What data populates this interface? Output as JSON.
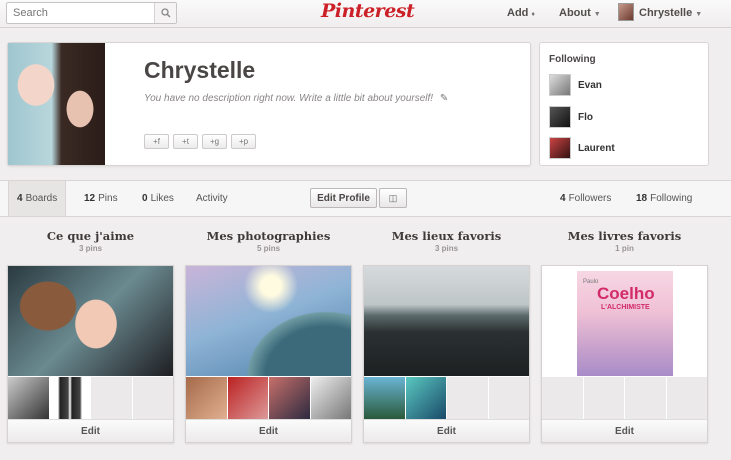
{
  "header": {
    "search_placeholder": "Search",
    "logo": "Pinterest",
    "add_label": "Add",
    "about_label": "About",
    "user_label": "Chrystelle"
  },
  "profile": {
    "name": "Chrystelle",
    "description": "You have no description right now. Write a little bit about yourself!",
    "social_buttons": [
      "+f",
      "+t",
      "+g",
      "+p"
    ]
  },
  "following": {
    "title": "Following",
    "users": [
      {
        "name": "Evan"
      },
      {
        "name": "Flo"
      },
      {
        "name": "Laurent"
      }
    ]
  },
  "tabs": {
    "boards_count": "4",
    "boards_label": "Boards",
    "pins_count": "12",
    "pins_label": "Pins",
    "likes_count": "0",
    "likes_label": "Likes",
    "activity_label": "Activity",
    "edit_profile_label": "Edit Profile",
    "followers_count": "4",
    "followers_label": "Followers",
    "following_count": "18",
    "following_label": "Following"
  },
  "boards": [
    {
      "title": "Ce que j'aime",
      "count": "3 pins",
      "edit": "Edit"
    },
    {
      "title": "Mes photographies",
      "count": "5 pins",
      "edit": "Edit"
    },
    {
      "title": "Mes lieux favoris",
      "count": "3 pins",
      "edit": "Edit"
    },
    {
      "title": "Mes livres favoris",
      "count": "1 pin",
      "edit": "Edit"
    }
  ],
  "book_cover": {
    "author": "Paulo",
    "surname": "Coelho",
    "title": "L'ALCHIMISTE"
  },
  "colors": {
    "brand": "#cb2027",
    "background": "#f0eeee"
  }
}
